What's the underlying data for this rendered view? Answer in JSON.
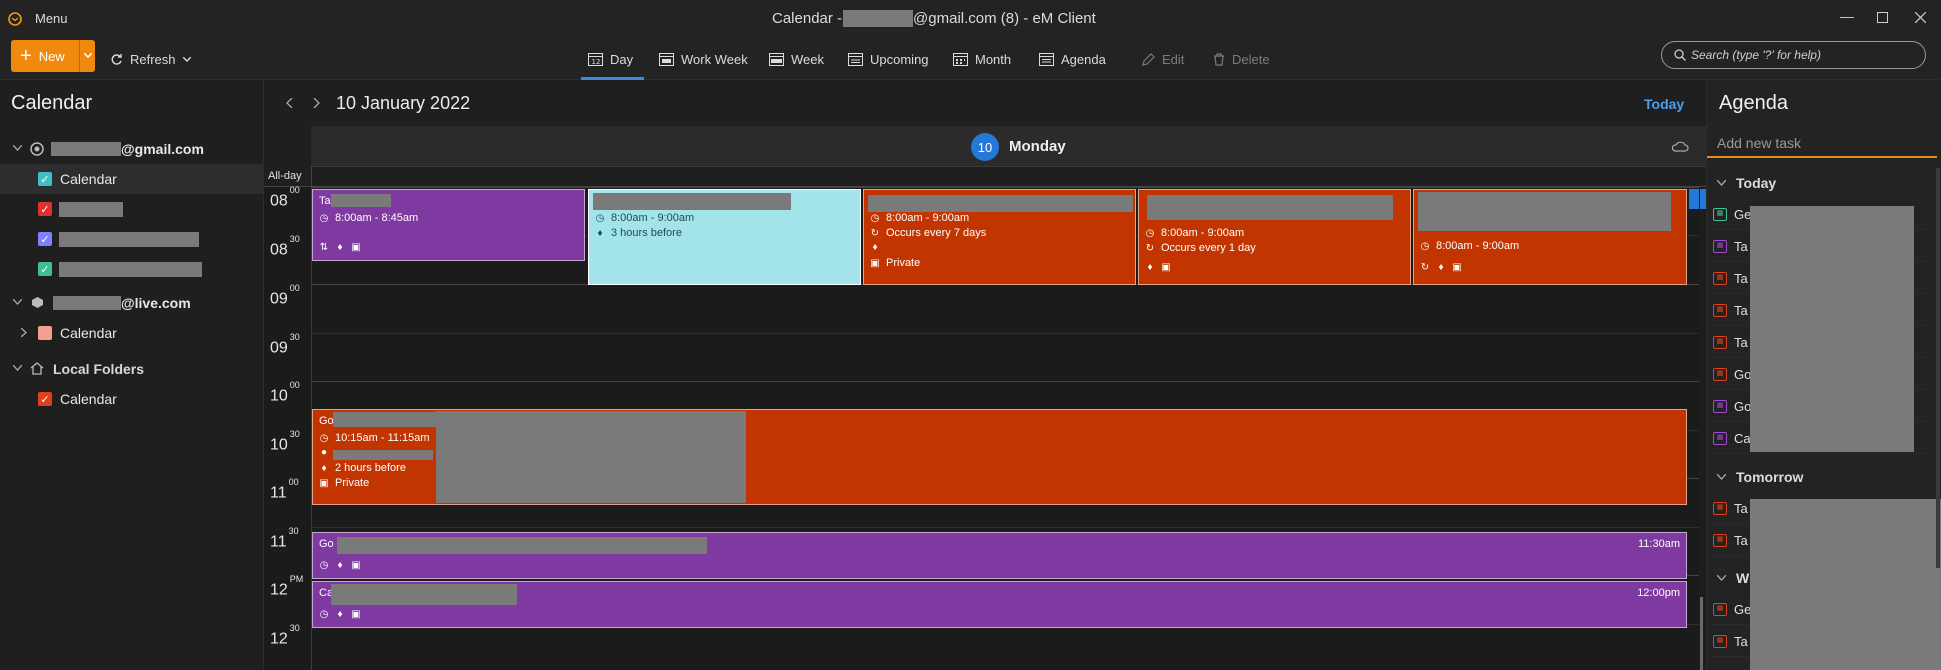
{
  "window": {
    "menu_label": "Menu",
    "title_prefix": "Calendar - ",
    "title_suffix": "@gmail.com (8) - eM Client"
  },
  "toolbar": {
    "new_label": "New",
    "refresh_label": "Refresh",
    "views": [
      "Day",
      "Work Week",
      "Week",
      "Upcoming",
      "Month",
      "Agenda"
    ],
    "active_view": "Day",
    "edit_label": "Edit",
    "delete_label": "Delete",
    "search_placeholder": "Search (type '?' for help)"
  },
  "sidebar": {
    "title": "Calendar",
    "gmail_account": "@gmail.com",
    "gmail_calendar": "Calendar",
    "live_account": "@live.com",
    "live_calendar": "Calendar",
    "local_folders": "Local Folders",
    "local_calendar": "Calendar",
    "colors": {
      "gmail_cal": "#3ec0c8",
      "red": "#e03030",
      "blue": "#8080ff",
      "green": "#40c090",
      "live_cal": "#f4a090",
      "local_cal": "#e0401a"
    }
  },
  "main": {
    "date_title": "10 January 2022",
    "today_label": "Today",
    "day_number": "10",
    "day_name": "Monday",
    "allday_label": "All-day",
    "time_labels": [
      {
        "h": "08",
        "m": "00"
      },
      {
        "h": "08",
        "m": "30"
      },
      {
        "h": "09",
        "m": "00"
      },
      {
        "h": "09",
        "m": "30"
      },
      {
        "h": "10",
        "m": "00"
      },
      {
        "h": "10",
        "m": "30"
      },
      {
        "h": "11",
        "m": "00"
      },
      {
        "h": "11",
        "m": "30"
      },
      {
        "h": "12",
        "m": "PM"
      },
      {
        "h": "12",
        "m": "30"
      }
    ]
  },
  "events": {
    "e1": {
      "title": "Ta",
      "time": "8:00am - 8:45am"
    },
    "e2": {
      "time": "8:00am - 9:00am",
      "reminder": "3 hours before"
    },
    "e3": {
      "time": "8:00am - 9:00am",
      "recurrence": "Occurs every 7 days",
      "privacy": "Private"
    },
    "e4": {
      "time": "8:00am - 9:00am",
      "recurrence": "Occurs every 1 day"
    },
    "e5": {
      "time": "8:00am - 9:00am"
    },
    "e6": {
      "title": "Go",
      "time": "10:15am - 11:15am",
      "reminder": "2 hours before",
      "privacy": "Private"
    },
    "e7": {
      "title": "Go",
      "time_right": "11:30am"
    },
    "e8": {
      "title": "Ca",
      "time_right": "12:00pm"
    },
    "colors": {
      "purple": "#7e3aa1",
      "orange": "#c23400",
      "cyan": "#a2e4ea"
    }
  },
  "agenda": {
    "title": "Agenda",
    "add_task_placeholder": "Add new task",
    "today_label": "Today",
    "tomorrow_label": "Tomorrow",
    "next_section_label": "W",
    "today_items": [
      "Ge",
      "Ta",
      "Ta",
      "Ta",
      "Ta",
      "Go",
      "Go",
      "Ca"
    ],
    "tomorrow_items": [
      "Ta",
      "Ta"
    ],
    "next_items": [
      "Ge",
      "Ta"
    ]
  }
}
